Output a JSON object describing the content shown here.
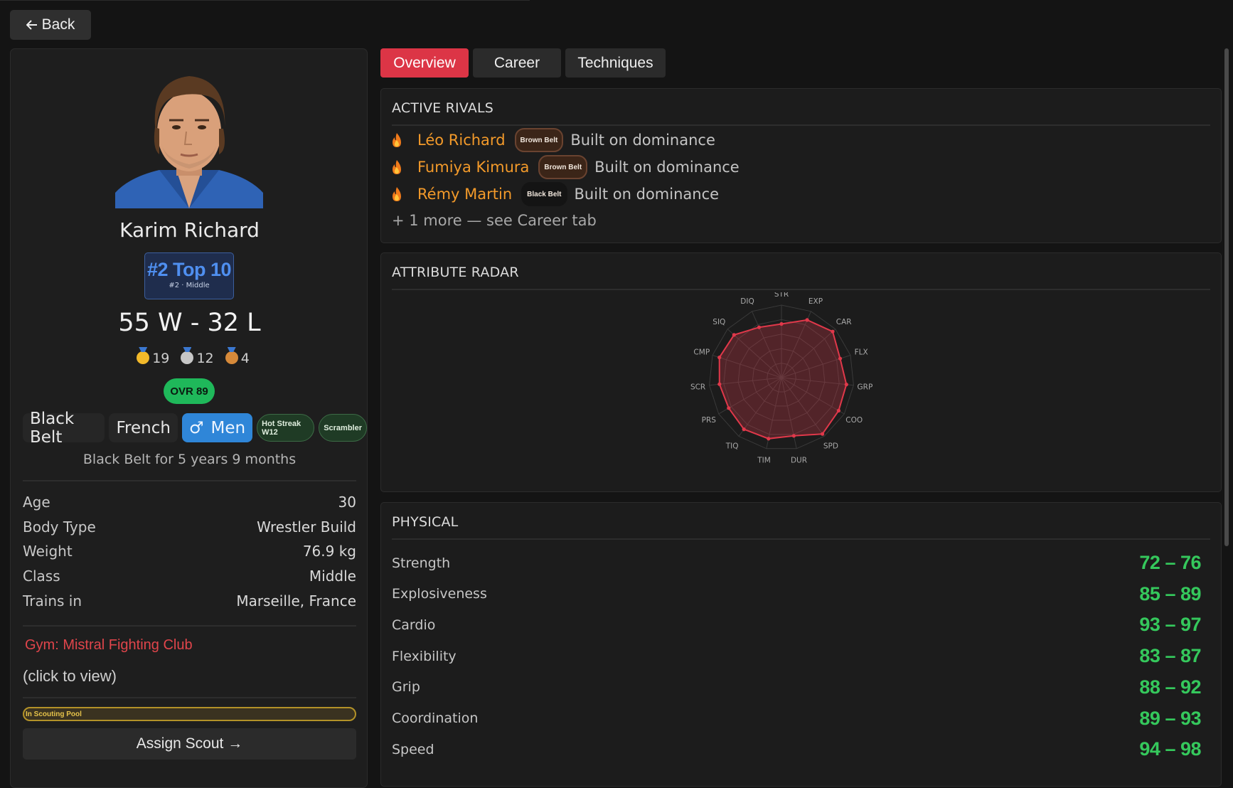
{
  "nav": {
    "back_label": "Back"
  },
  "profile": {
    "name": "Karim Richard",
    "rank_main": "#2 Top 10",
    "rank_sub": "#2 · Middle",
    "record": "55 W - 32 L",
    "medals": {
      "gold": "19",
      "silver": "12",
      "bronze": "4"
    },
    "ovr": "OVR 89",
    "tags": [
      "Black Belt",
      "French",
      "Men"
    ],
    "pills": [
      "Hot Streak W12",
      "Scrambler"
    ],
    "belt_duration": "Black Belt for 5 years 9 months",
    "info": [
      {
        "label": "Age",
        "value": "30"
      },
      {
        "label": "Body Type",
        "value": "Wrestler Build"
      },
      {
        "label": "Weight",
        "value": "76.9 kg"
      },
      {
        "label": "Class",
        "value": "Middle"
      },
      {
        "label": "Trains in",
        "value": "Marseille, France"
      }
    ],
    "gym": "Gym: Mistral Fighting Club",
    "gym_hint": "(click to view)",
    "scouting": "In Scouting Pool",
    "assign_scout": "Assign Scout →"
  },
  "tabs": [
    "Overview",
    "Career",
    "Techniques"
  ],
  "active_tab": "Overview",
  "rivals": {
    "title": "ACTIVE RIVALS",
    "items": [
      {
        "name": "Léo Richard",
        "belt": "Brown Belt",
        "belt_color": "#3b2518",
        "desc": "Built on dominance"
      },
      {
        "name": "Fumiya Kimura",
        "belt": "Brown Belt",
        "belt_color": "#3b2518",
        "desc": "Built on dominance"
      },
      {
        "name": "Rémy Martin",
        "belt": "Black Belt",
        "belt_color": "#141414",
        "desc": "Built on dominance"
      }
    ],
    "more": "+ 1 more — see Career tab"
  },
  "radar": {
    "title": "ATTRIBUTE RADAR"
  },
  "chart_data": {
    "type": "radar",
    "categories": [
      "STR",
      "EXP",
      "CAR",
      "FLX",
      "GRP",
      "COO",
      "SPD",
      "DUR",
      "TIM",
      "TIQ",
      "PRS",
      "SCR",
      "CMP",
      "SIQ",
      "DIQ"
    ],
    "values": [
      74,
      87,
      95,
      85,
      90,
      91,
      96,
      82,
      86,
      88,
      84,
      86,
      90,
      88,
      76
    ],
    "range": [
      0,
      100
    ],
    "color": "#e0384a"
  },
  "physical": {
    "title": "PHYSICAL",
    "items": [
      {
        "name": "Strength",
        "value": "72 – 76"
      },
      {
        "name": "Explosiveness",
        "value": "85 – 89"
      },
      {
        "name": "Cardio",
        "value": "93 – 97"
      },
      {
        "name": "Flexibility",
        "value": "83 – 87"
      },
      {
        "name": "Grip",
        "value": "88 – 92"
      },
      {
        "name": "Coordination",
        "value": "89 – 93"
      },
      {
        "name": "Speed",
        "value": "94 – 98"
      }
    ]
  },
  "colors": {
    "accent": "#dc3546",
    "rival_name": "#f39a2a",
    "attr_value": "#35c85c",
    "rank": "#4f8ff0"
  }
}
